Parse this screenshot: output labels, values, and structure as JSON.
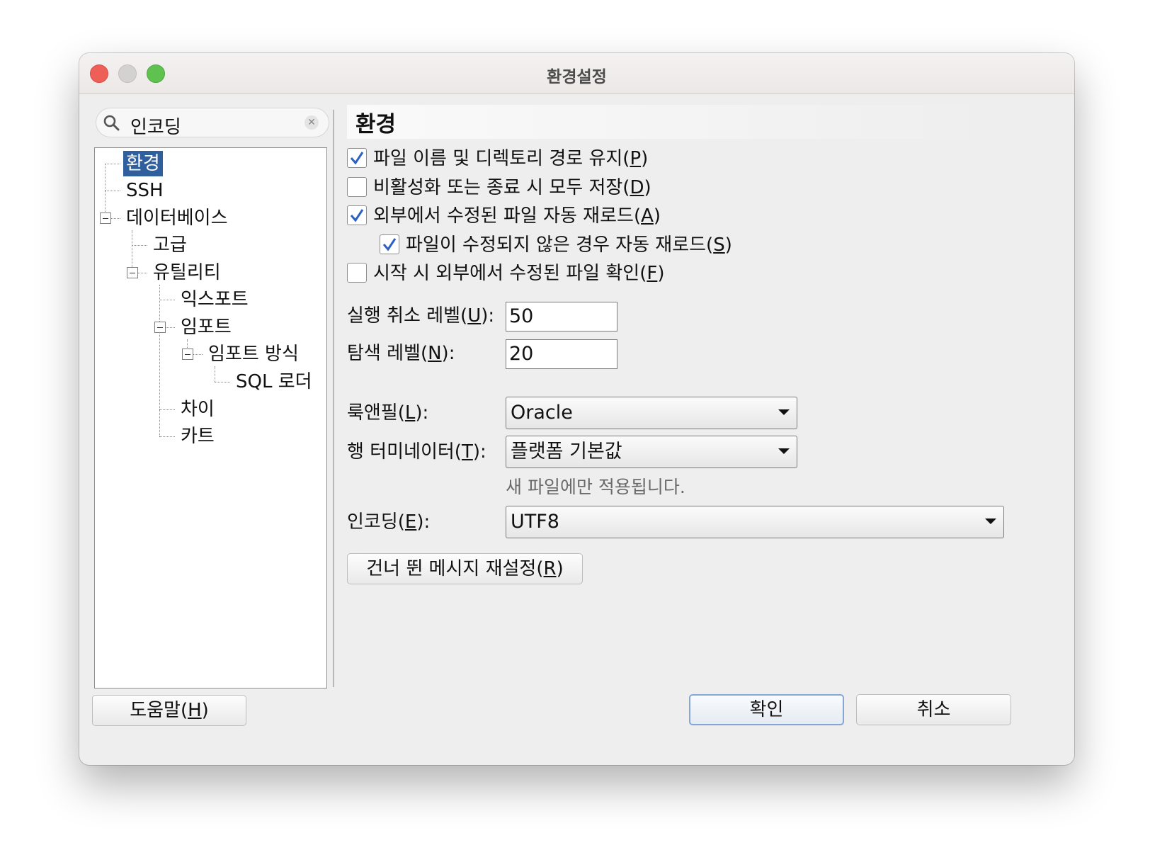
{
  "window": {
    "title": "환경설정"
  },
  "search": {
    "value": "인코딩"
  },
  "tree": {
    "items": [
      {
        "label": "환경",
        "selected": true
      },
      {
        "label": "SSH"
      },
      {
        "label": "데이터베이스"
      },
      {
        "label": "고급"
      },
      {
        "label": "유틸리티"
      },
      {
        "label": "익스포트"
      },
      {
        "label": "임포트"
      },
      {
        "label": "임포트 방식"
      },
      {
        "label": "SQL 로더"
      },
      {
        "label": "차이"
      },
      {
        "label": "카트"
      }
    ]
  },
  "panel": {
    "header": "환경",
    "checkboxes": [
      {
        "label": "파일 이름 및 디렉토리 경로 유지(",
        "mnemonic": "P",
        "suffix": ")",
        "checked": true
      },
      {
        "label": "비활성화 또는 종료 시 모두 저장(",
        "mnemonic": "D",
        "suffix": ")",
        "checked": false
      },
      {
        "label": "외부에서 수정된 파일 자동 재로드(",
        "mnemonic": "A",
        "suffix": ")",
        "checked": true
      },
      {
        "label": "파일이 수정되지 않은 경우 자동 재로드(",
        "mnemonic": "S",
        "suffix": ")",
        "checked": true
      },
      {
        "label": "시작 시 외부에서 수정된 파일 확인(",
        "mnemonic": "F",
        "suffix": ")",
        "checked": false
      }
    ],
    "undo_level": {
      "label": "실행 취소 레벨(",
      "mnemonic": "U",
      "suffix": "):",
      "value": "50"
    },
    "nav_level": {
      "label": "탐색 레벨(",
      "mnemonic": "N",
      "suffix": "):",
      "value": "20"
    },
    "look_feel": {
      "label": "룩앤필(",
      "mnemonic": "L",
      "suffix": "):",
      "value": "Oracle"
    },
    "line_terminator": {
      "label": "행 터미네이터(",
      "mnemonic": "T",
      "suffix": "):",
      "value": "플랫폼 기본값",
      "hint": "새 파일에만 적용됩니다."
    },
    "encoding": {
      "label": "인코딩(",
      "mnemonic": "E",
      "suffix": "):",
      "value": "UTF8"
    },
    "reset_button": {
      "label": "건너 뛴 메시지 재설정(",
      "mnemonic": "R",
      "suffix": ")"
    }
  },
  "footer": {
    "help": {
      "label": "도움말(",
      "mnemonic": "H",
      "suffix": ")"
    },
    "ok": "확인",
    "cancel": "취소"
  },
  "colors": {
    "selection": "#2f5f9c",
    "check": "#2d61c1",
    "default_button_border": "#86a7d6"
  }
}
